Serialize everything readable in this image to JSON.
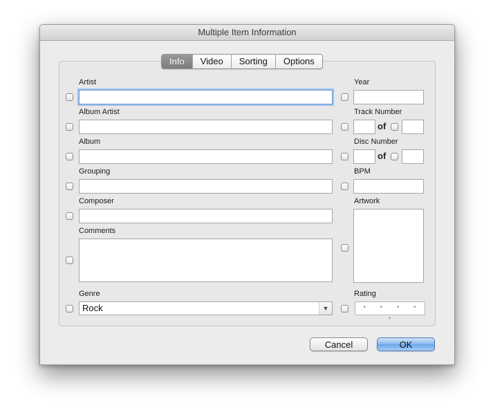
{
  "window": {
    "title": "Multiple Item Information"
  },
  "tabs": [
    {
      "label": "Info",
      "active": true
    },
    {
      "label": "Video",
      "active": false
    },
    {
      "label": "Sorting",
      "active": false
    },
    {
      "label": "Options",
      "active": false
    }
  ],
  "fields": {
    "artist": {
      "label": "Artist",
      "value": ""
    },
    "album_artist": {
      "label": "Album Artist",
      "value": ""
    },
    "album": {
      "label": "Album",
      "value": ""
    },
    "grouping": {
      "label": "Grouping",
      "value": ""
    },
    "composer": {
      "label": "Composer",
      "value": ""
    },
    "comments": {
      "label": "Comments",
      "value": ""
    },
    "genre": {
      "label": "Genre",
      "value": "Rock"
    },
    "year": {
      "label": "Year",
      "value": ""
    },
    "track_number": {
      "label": "Track Number",
      "of": "of",
      "value": "",
      "total": ""
    },
    "disc_number": {
      "label": "Disc Number",
      "of": "of",
      "value": "",
      "total": ""
    },
    "bpm": {
      "label": "BPM",
      "value": ""
    },
    "artwork": {
      "label": "Artwork"
    },
    "rating": {
      "label": "Rating",
      "dots": "• • • • •"
    }
  },
  "buttons": {
    "cancel": "Cancel",
    "ok": "OK"
  },
  "colors": {
    "focus_ring": "#9bbfeb",
    "ok_button": "#86b7ef",
    "active_tab": "#8a8a8a"
  }
}
